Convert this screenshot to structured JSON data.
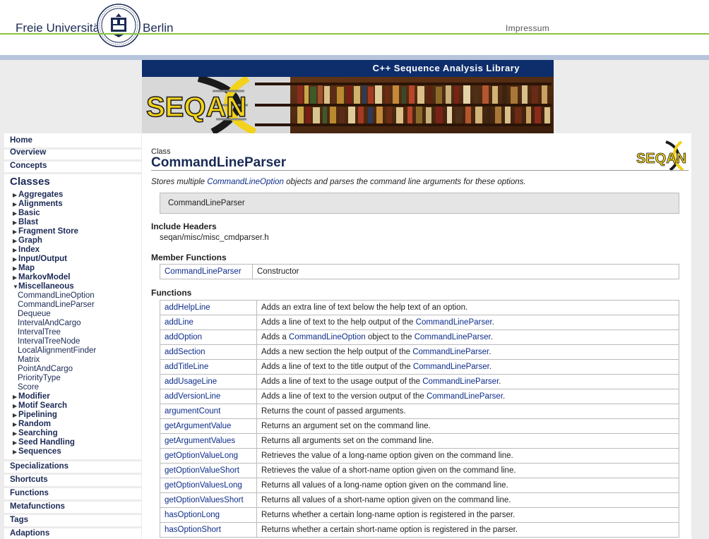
{
  "header": {
    "university_left": "Freie Universität",
    "university_right": "Berlin",
    "impressum": "Impressum"
  },
  "banner": {
    "title": "C++ Sequence Analysis Library",
    "logo_text": "SEQAN"
  },
  "sidebar": {
    "top_items": [
      "Home",
      "Overview",
      "Concepts"
    ],
    "classes_header": "Classes",
    "categories": [
      "Aggregates",
      "Alignments",
      "Basic",
      "Blast",
      "Fragment Store",
      "Graph",
      "Index",
      "Input/Output",
      "Map",
      "MarkovModel"
    ],
    "expanded_category": "Miscellaneous",
    "sub_items": [
      "CommandLineOption",
      "CommandLineParser",
      "Dequeue",
      "IntervalAndCargo",
      "IntervalTree",
      "IntervalTreeNode",
      "LocalAlignmentFinder",
      "Matrix",
      "PointAndCargo",
      "PriorityType",
      "Score"
    ],
    "categories_after": [
      "Modifier",
      "Motif Search",
      "Pipelining",
      "Random",
      "Searching",
      "Seed Handling",
      "Sequences"
    ],
    "bottom_items": [
      "Specializations",
      "Shortcuts",
      "Functions",
      "Metafunctions",
      "Tags",
      "Adaptions"
    ]
  },
  "content": {
    "class_label": "Class",
    "class_name": "CommandLineParser",
    "logo_text": "SEQAN",
    "description_prefix": "Stores multiple ",
    "description_link": "CommandLineOption",
    "description_suffix": " objects and parses the command line arguments for these options.",
    "signature": "CommandLineParser",
    "include_header_title": "Include Headers",
    "include_path": "seqan/misc/misc_cmdparser.h",
    "member_functions_title": "Member Functions",
    "member_functions": [
      {
        "name": "CommandLineParser",
        "desc": "Constructor"
      }
    ],
    "functions_title": "Functions",
    "functions": [
      {
        "name": "addHelpLine",
        "desc": "Adds an extra line of text below the help text of an option."
      },
      {
        "name": "addLine",
        "desc_pre": "Adds a line of text to the help output of the ",
        "link": "CommandLineParser",
        "desc_post": "."
      },
      {
        "name": "addOption",
        "desc_pre": "Adds a ",
        "link": "CommandLineOption",
        "desc_mid": " object to the ",
        "link2": "CommandLineParser",
        "desc_post": "."
      },
      {
        "name": "addSection",
        "desc_pre": "Adds a new section the help output of the ",
        "link": "CommandLineParser",
        "desc_post": "."
      },
      {
        "name": "addTitleLine",
        "desc_pre": "Adds a line of text to the title output of the ",
        "link": "CommandLineParser",
        "desc_post": "."
      },
      {
        "name": "addUsageLine",
        "desc_pre": "Adds a line of text to the usage output of the ",
        "link": "CommandLineParser",
        "desc_post": "."
      },
      {
        "name": "addVersionLine",
        "desc_pre": "Adds a line of text to the version output of the ",
        "link": "CommandLineParser",
        "desc_post": "."
      },
      {
        "name": "argumentCount",
        "desc": "Returns the count of passed arguments."
      },
      {
        "name": "getArgumentValue",
        "desc": "Returns an argument set on the command line."
      },
      {
        "name": "getArgumentValues",
        "desc": "Returns all arguments set on the command line."
      },
      {
        "name": "getOptionValueLong",
        "desc": "Retrieves the value of a long-name option given on the command line."
      },
      {
        "name": "getOptionValueShort",
        "desc": "Retrieves the value of a short-name option given on the command line."
      },
      {
        "name": "getOptionValuesLong",
        "desc": "Returns all values of a long-name option given on the command line."
      },
      {
        "name": "getOptionValuesShort",
        "desc": "Returns all values of a short-name option given on the command line."
      },
      {
        "name": "hasOptionLong",
        "desc": "Returns whether a certain long-name option is registered in the parser."
      },
      {
        "name": "hasOptionShort",
        "desc": "Returns whether a certain short-name option is registered in the parser."
      }
    ]
  },
  "colors": {
    "navy": "#0d2d6b",
    "link": "#0d2d8b",
    "green_rule": "#8bc43f",
    "blue_rule": "#b7c4dc",
    "logo_yellow": "#f2d21a"
  }
}
